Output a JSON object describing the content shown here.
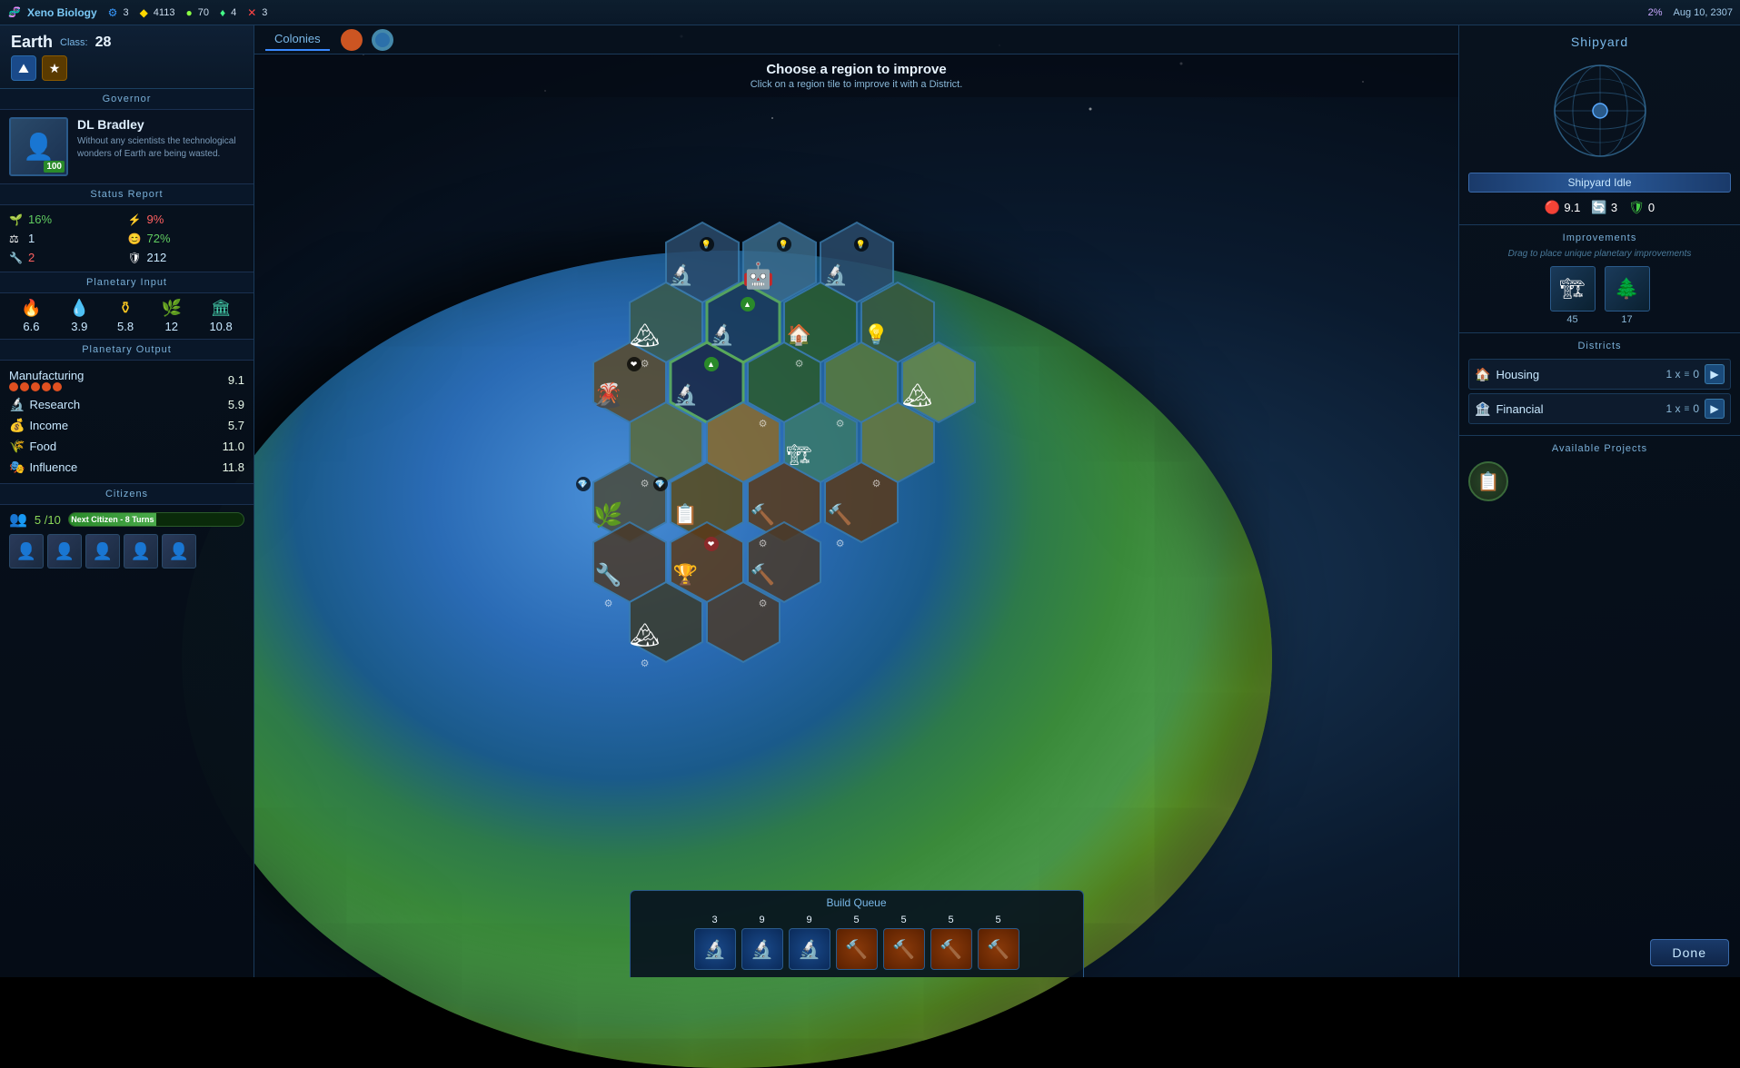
{
  "topbar": {
    "game_title": "Xeno Biology",
    "icons": {
      "tech": "🧬",
      "shield": "🛡",
      "food_icon": "🌿",
      "warning": "⚠"
    },
    "tech_count": "3",
    "currency": "4113",
    "resource1": "70",
    "resource2": "4",
    "warning_count": "3",
    "percent": "2%",
    "date": "Aug 10, 2307"
  },
  "left_panel": {
    "planet_name": "Earth",
    "planet_class_label": "Class:",
    "planet_class": "28",
    "governor_label": "Governor",
    "governor_name": "DL Bradley",
    "governor_desc": "Without any scientists the technological wonders of Earth are being wasted.",
    "governor_level": "100",
    "status_label": "Status Report",
    "status_items": [
      {
        "icon": "🌱",
        "val": "16%",
        "color": "green"
      },
      {
        "icon": "⚡",
        "val": "9%",
        "color": "red"
      },
      {
        "icon": "⚖",
        "val": "1",
        "color": "normal"
      },
      {
        "icon": "😊",
        "val": "72%",
        "color": "green"
      },
      {
        "icon": "🔧",
        "val": "2",
        "color": "red"
      },
      {
        "icon": "🛡",
        "val": "212",
        "color": "normal"
      }
    ],
    "input_label": "Planetary Input",
    "inputs": [
      {
        "icon": "🔥",
        "val": "6.6",
        "color": "orange"
      },
      {
        "icon": "💧",
        "val": "3.9",
        "color": "blue"
      },
      {
        "icon": "⚱",
        "val": "5.8",
        "color": "yellow"
      },
      {
        "icon": "🌿",
        "val": "12",
        "color": "green"
      },
      {
        "icon": "🏛",
        "val": "10.8",
        "color": "teal"
      }
    ],
    "output_label": "Planetary Output",
    "outputs": [
      {
        "name": "Manufacturing",
        "val": "9.1",
        "stars": 5,
        "star_color": "orange"
      },
      {
        "name": "Research",
        "val": "5.9",
        "icon": "🔬"
      },
      {
        "name": "Income",
        "val": "5.7",
        "icon": "💰"
      },
      {
        "name": "Food",
        "val": "11.0",
        "icon": "🌾"
      },
      {
        "name": "Influence",
        "val": "11.8",
        "icon": "🎭"
      }
    ],
    "citizens_label": "Citizens",
    "citizen_count": "5 /10",
    "next_citizen_label": "Next Citizen - 8 Turns",
    "citizen_bar_pct": 50,
    "citizen_avatars": [
      "👤",
      "👤",
      "👤",
      "👤",
      "👤"
    ]
  },
  "center": {
    "colonies_label": "Colonies",
    "mission_title": "Choose a region to improve",
    "mission_sub": "Click on a region tile to improve it with a District.",
    "build_queue_label": "Build Queue",
    "build_items": [
      {
        "num": "3",
        "type": "blue",
        "icon": "🔬"
      },
      {
        "num": "9",
        "type": "blue",
        "icon": "🔬"
      },
      {
        "num": "9",
        "type": "blue",
        "icon": "🔬"
      },
      {
        "num": "5",
        "type": "orange",
        "icon": "🔨"
      },
      {
        "num": "5",
        "type": "orange",
        "icon": "🔨"
      },
      {
        "num": "5",
        "type": "orange",
        "icon": "🔨"
      },
      {
        "num": "5",
        "type": "orange",
        "icon": "🔨"
      }
    ]
  },
  "right_panel": {
    "shipyard_title": "Shipyard",
    "shipyard_name": "Shipyard Idle",
    "shipyard_stats": [
      {
        "val": "9.1",
        "color": "red",
        "icon": "🔴"
      },
      {
        "val": "3",
        "color": "blue",
        "icon": "🔄"
      },
      {
        "val": "0",
        "color": "green",
        "icon": "🛡"
      }
    ],
    "improvements_title": "Improvements",
    "improvements_sub": "Drag to place unique planetary improvements",
    "improvements": [
      {
        "icon": "🏗",
        "num": "45"
      },
      {
        "icon": "🌲",
        "num": "17"
      }
    ],
    "districts_title": "Districts",
    "districts": [
      {
        "icon": "🏠",
        "name": "Housing",
        "count": "1 x",
        "signal": "≡",
        "num": "0"
      },
      {
        "icon": "🏦",
        "name": "Financial",
        "count": "1 x",
        "signal": "≡",
        "num": "0"
      }
    ],
    "projects_title": "Available Projects",
    "projects": [
      {
        "icon": "📋"
      }
    ],
    "done_label": "Done"
  }
}
